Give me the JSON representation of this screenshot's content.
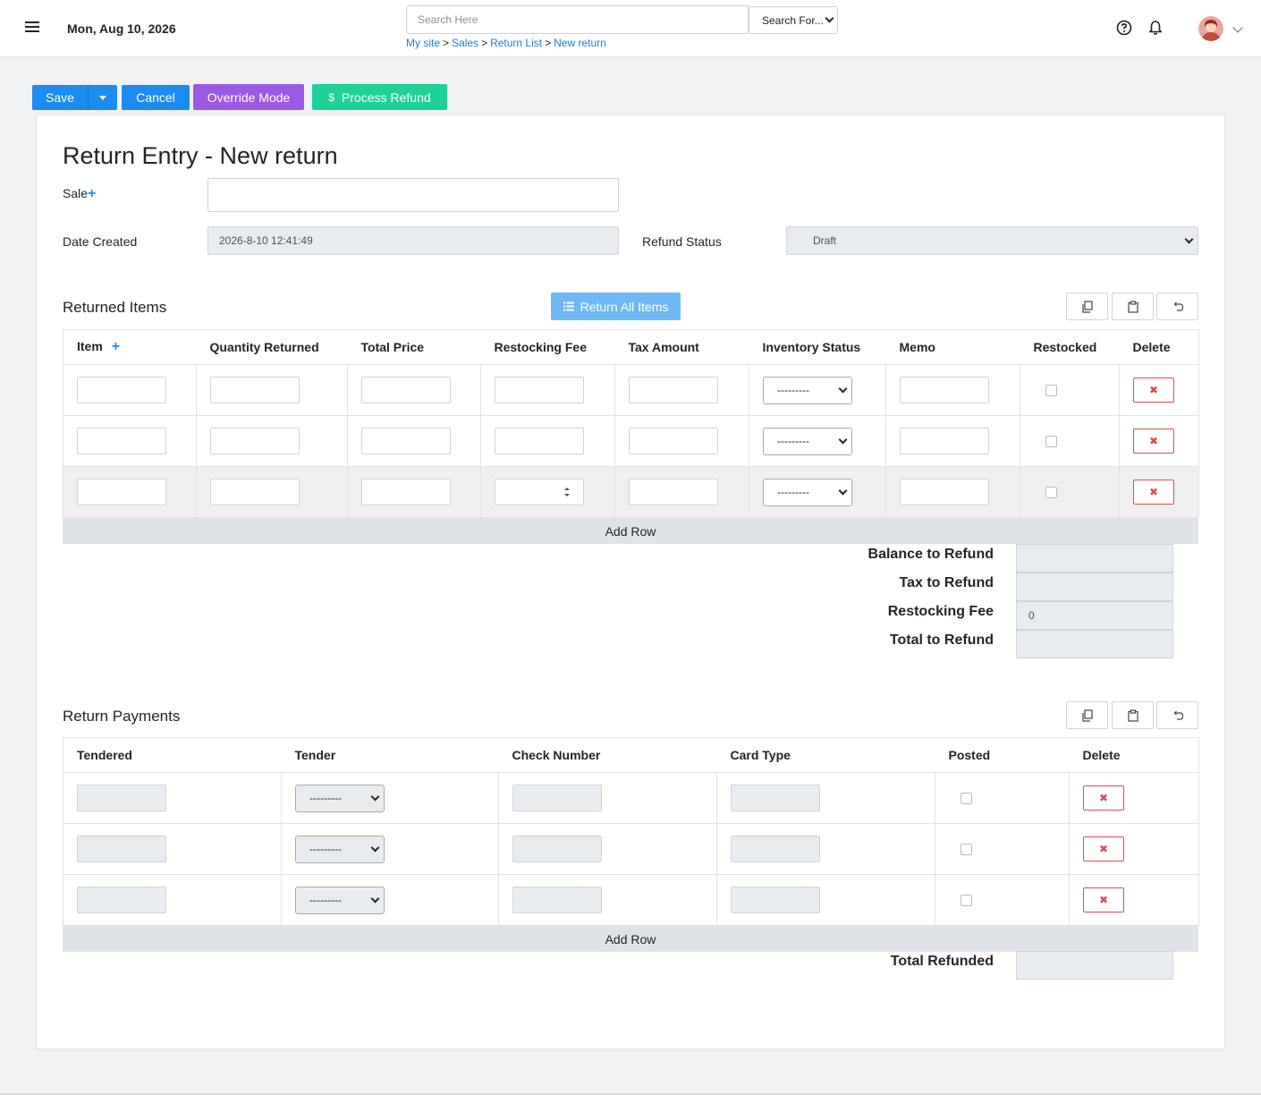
{
  "header": {
    "date": "Mon, Aug 10, 2026",
    "search_placeholder": "Search Here",
    "search_for": "Search For...",
    "breadcrumb": [
      "My site",
      "Sales",
      "Return List",
      "New return"
    ]
  },
  "toolbar": {
    "save": "Save",
    "cancel": "Cancel",
    "override": "Override Mode",
    "refund_icon": "$",
    "process_refund": "Process Refund"
  },
  "form": {
    "title": "Return Entry - New return",
    "sale_label": "Sale",
    "date_created_label": "Date Created",
    "date_created_value": "2026-8-10 12:41:49",
    "refund_status_label": "Refund Status",
    "refund_status_value": "Draft"
  },
  "returned_items": {
    "title": "Returned Items",
    "return_all": "Return All Items",
    "columns": [
      "Item",
      "Quantity Returned",
      "Total Price",
      "Restocking Fee",
      "Tax Amount",
      "Inventory Status",
      "Memo",
      "Restocked",
      "Delete"
    ],
    "inventory_placeholder": "---------",
    "add_row": "Add Row"
  },
  "summary": {
    "balance_label": "Balance to Refund",
    "tax_label": "Tax to Refund",
    "restocking_label": "Restocking Fee",
    "restocking_value": "0",
    "total_label": "Total to Refund"
  },
  "payments": {
    "title": "Return Payments",
    "columns": [
      "Tendered",
      "Tender",
      "Check Number",
      "Card Type",
      "Posted",
      "Delete"
    ],
    "tender_placeholder": "---------",
    "add_row": "Add Row",
    "total_refunded_label": "Total Refunded"
  },
  "colors": {
    "primary": "#1d8cf0",
    "override": "#9b59e6",
    "refund": "#1ed196",
    "danger": "#e04b4b"
  }
}
